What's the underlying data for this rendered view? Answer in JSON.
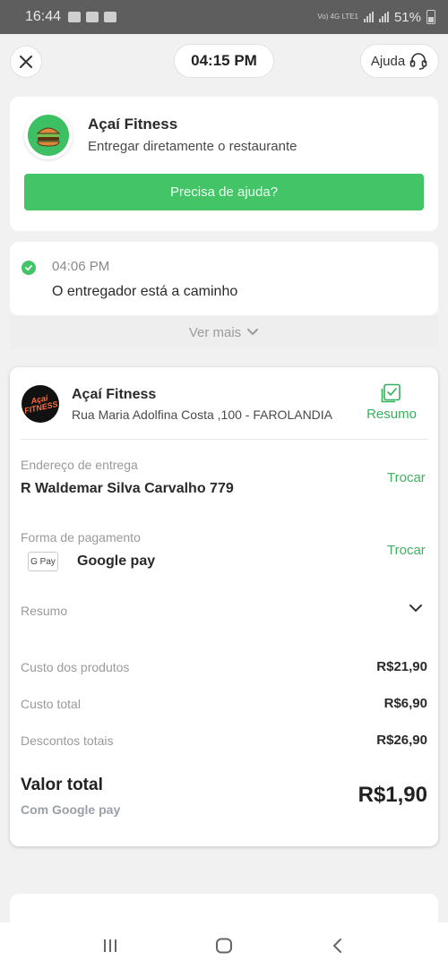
{
  "status_bar": {
    "time": "16:44",
    "network": "Vo) 4G LTE1",
    "battery": "51%"
  },
  "header": {
    "time_pill": "04:15 PM",
    "help_label": "Ajuda"
  },
  "restaurant_card": {
    "name": "Açaí Fitness",
    "subtitle": "Entregar diretamente o restaurante",
    "help_button": "Precisa de ajuda?"
  },
  "status_card": {
    "time": "04:06 PM",
    "message": "O entregador está a caminho",
    "more_label": "Ver mais"
  },
  "order_card": {
    "store_name": "Açaí Fitness",
    "store_address": "Rua Maria Adolfina Costa ,100 - FAROLANDIA",
    "logo_text": "Açaí FITNESS",
    "summary_link": "Resumo",
    "delivery": {
      "label": "Endereço de entrega",
      "value": "R Waldemar Silva Carvalho 779",
      "change": "Trocar"
    },
    "payment": {
      "label": "Forma de pagamento",
      "badge": "G Pay",
      "value": "Google pay",
      "change": "Trocar"
    },
    "summary_label": "Resumo",
    "costs": [
      {
        "label": "Custo dos produtos",
        "value": "R$21,90"
      },
      {
        "label": "Custo total",
        "value": "R$6,90"
      },
      {
        "label": "Descontos totais",
        "value": "R$26,90"
      }
    ],
    "total": {
      "label": "Valor total",
      "method": "Com Google pay",
      "value": "R$1,90"
    }
  },
  "colors": {
    "accent_green": "#42c467",
    "link_green": "#3fb262",
    "status_bar": "#5e5e5e"
  },
  "icons": [
    "close-icon",
    "headset-icon",
    "burger-icon",
    "check-circle-icon",
    "chevron-down-icon",
    "receipt-icon",
    "recents-icon",
    "home-icon",
    "back-icon"
  ]
}
